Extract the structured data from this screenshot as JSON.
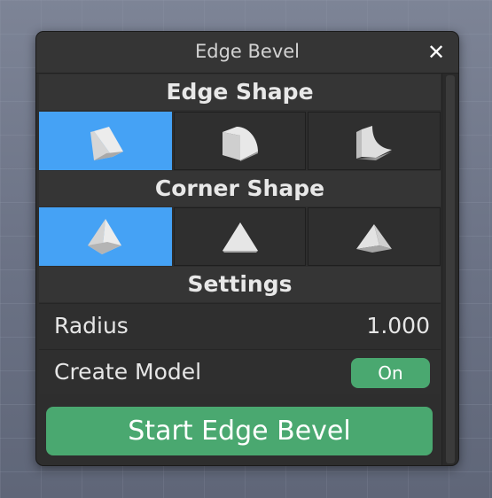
{
  "window": {
    "title": "Edge Bevel",
    "close_icon": "close-icon"
  },
  "edge_shape": {
    "header": "Edge Shape",
    "options": [
      {
        "icon": "wedge-shape-icon",
        "selected": true
      },
      {
        "icon": "rounded-shape-icon",
        "selected": false
      },
      {
        "icon": "concave-shape-icon",
        "selected": false
      }
    ]
  },
  "corner_shape": {
    "header": "Corner Shape",
    "options": [
      {
        "icon": "pyramid-corner-icon",
        "selected": true
      },
      {
        "icon": "triangle-corner-icon",
        "selected": false
      },
      {
        "icon": "flat-triangle-corner-icon",
        "selected": false
      }
    ]
  },
  "settings": {
    "header": "Settings",
    "radius_label": "Radius",
    "radius_value": "1.000",
    "create_model_label": "Create Model",
    "create_model_toggle": "On"
  },
  "start_button": "Start Edge Bevel",
  "colors": {
    "selected": "#45a2f5",
    "accent_green": "#4aa870",
    "panel": "#2e2e2e"
  }
}
